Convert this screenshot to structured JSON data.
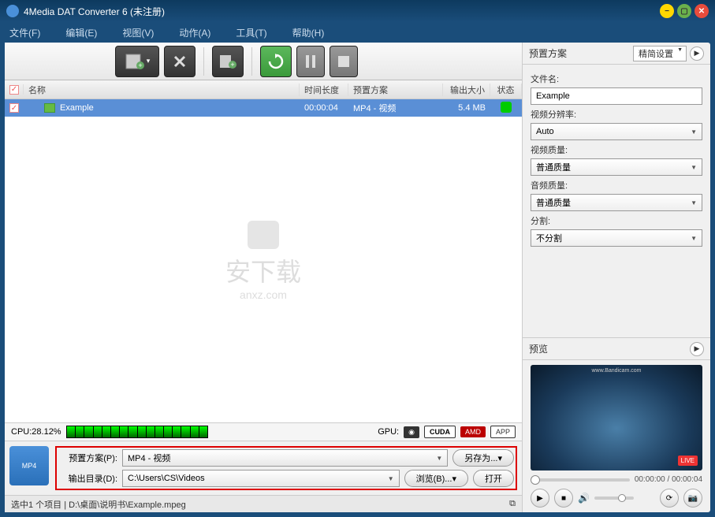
{
  "title": "4Media DAT Converter 6 (未注册)",
  "menu": {
    "file": "文件(F)",
    "edit": "编辑(E)",
    "view": "视图(V)",
    "action": "动作(A)",
    "tools": "工具(T)",
    "help": "帮助(H)"
  },
  "columns": {
    "name": "名称",
    "duration": "时间长度",
    "plan": "预置方案",
    "size": "输出大小",
    "status": "状态"
  },
  "file": {
    "name": "Example",
    "duration": "00:00:04",
    "plan": "MP4 - 视频",
    "size": "5.4 MB"
  },
  "cpu": {
    "label": "CPU:28.12%",
    "gpu_label": "GPU:",
    "cuda": "CUDA",
    "amd": "AMD",
    "app": "APP"
  },
  "bottom": {
    "plan_label": "预置方案(P):",
    "plan_value": "MP4 - 视频",
    "saveas": "另存为...",
    "out_label": "输出目录(D):",
    "out_value": "C:\\Users\\CS\\Videos",
    "browse": "浏览(B)...",
    "open": "打开",
    "format_badge": "MP4"
  },
  "status": "选中1 个项目 | D:\\桌面\\说明书\\Example.mpeg",
  "right": {
    "preset_header": "预置方案",
    "preset_mode": "精简设置",
    "filename_label": "文件名:",
    "filename_value": "Example",
    "resolution_label": "视频分辨率:",
    "resolution_value": "Auto",
    "vquality_label": "视频质量:",
    "vquality_value": "普通质量",
    "aquality_label": "音频质量:",
    "aquality_value": "普通质量",
    "split_label": "分割:",
    "split_value": "不分割",
    "preview_header": "预览",
    "preview_wm": "www.Bandicam.com",
    "preview_live": "LIVE",
    "time": "00:00:00 / 00:00:04"
  },
  "watermark": {
    "main": "安下载",
    "sub": "anxz.com"
  }
}
